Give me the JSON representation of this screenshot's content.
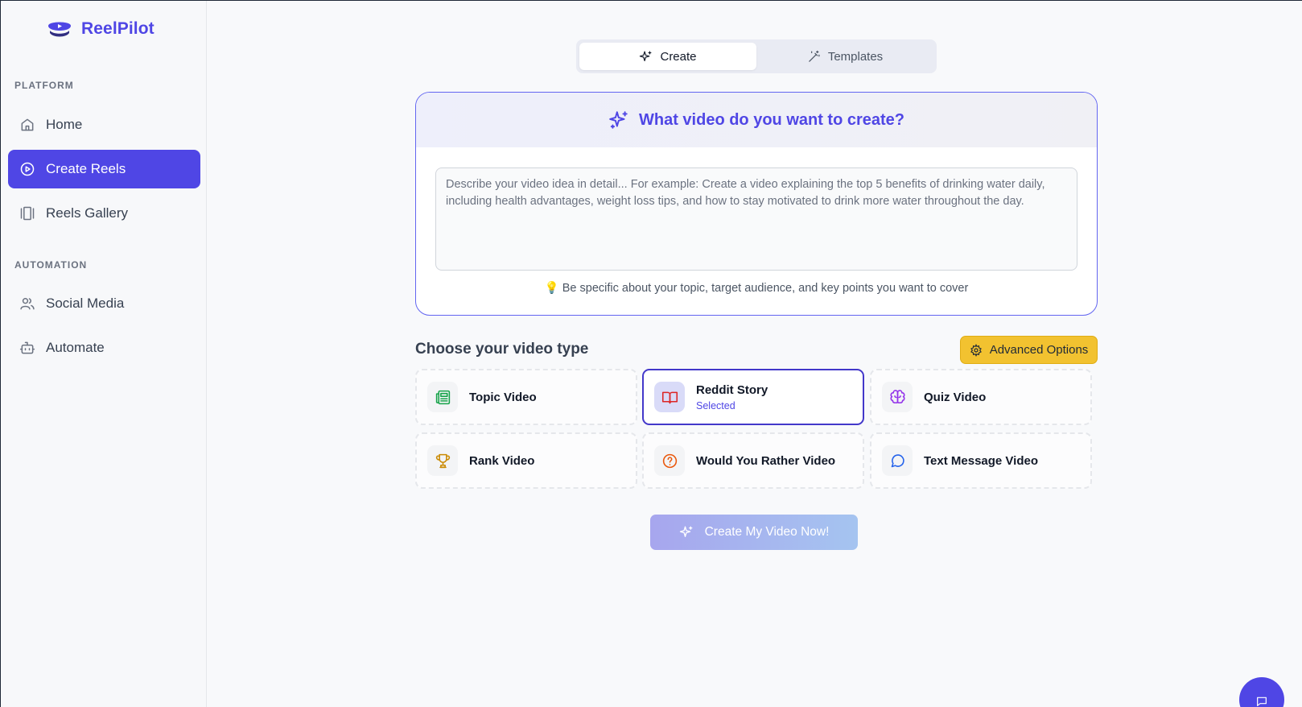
{
  "brand": {
    "name": "ReelPilot"
  },
  "sidebar": {
    "sections": [
      {
        "label": "PLATFORM",
        "items": [
          {
            "label": "Home",
            "icon": "home-icon",
            "active": false
          },
          {
            "label": "Create Reels",
            "icon": "play-circle-icon",
            "active": true
          },
          {
            "label": "Reels Gallery",
            "icon": "gallery-icon",
            "active": false
          }
        ]
      },
      {
        "label": "AUTOMATION",
        "items": [
          {
            "label": "Social Media",
            "icon": "users-icon",
            "active": false
          },
          {
            "label": "Automate",
            "icon": "bot-icon",
            "active": false
          }
        ]
      }
    ]
  },
  "tabs": [
    {
      "label": "Create",
      "icon": "sparkles-icon",
      "active": true
    },
    {
      "label": "Templates",
      "icon": "magic-wand-icon",
      "active": false
    }
  ],
  "prompt": {
    "title": "What video do you want to create?",
    "placeholder": "Describe your video idea in detail... For example: Create a video explaining the top 5 benefits of drinking water daily, including health advantages, weight loss tips, and how to stay motivated to drink more water throughout the day.",
    "value": "",
    "hint": "💡 Be specific about your topic, target audience, and key points you want to cover"
  },
  "video_types": {
    "title": "Choose your video type",
    "advanced_label": "Advanced Options",
    "selected_label": "Selected",
    "options": [
      {
        "label": "Topic Video",
        "icon": "newspaper-icon",
        "color": "#16a34a",
        "selected": false
      },
      {
        "label": "Reddit Story",
        "icon": "book-open-icon",
        "color": "#dc2626",
        "selected": true
      },
      {
        "label": "Quiz Video",
        "icon": "brain-icon",
        "color": "#9333ea",
        "selected": false
      },
      {
        "label": "Rank Video",
        "icon": "trophy-icon",
        "color": "#ca8a04",
        "selected": false
      },
      {
        "label": "Would You Rather Video",
        "icon": "question-circle-icon",
        "color": "#ea580c",
        "selected": false
      },
      {
        "label": "Text Message Video",
        "icon": "chat-bubble-icon",
        "color": "#2563eb",
        "selected": false
      }
    ]
  },
  "cta": {
    "label": "Create My Video Now!"
  },
  "colors": {
    "accent": "#4f46e5",
    "advanced_button": "#f2c230",
    "selected_border": "#4338ca"
  }
}
